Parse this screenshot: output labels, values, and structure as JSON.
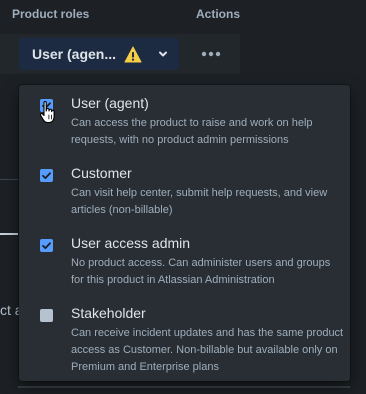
{
  "header": {
    "product_roles": "Product roles",
    "actions": "Actions"
  },
  "role_select": {
    "value": "User (agen...",
    "icons": [
      "warning-icon",
      "chevron-down-icon"
    ]
  },
  "more_actions": {
    "icon": "more-horizontal-icon"
  },
  "background": {
    "clipped_text": "ct a"
  },
  "options": [
    {
      "title": "User (agent)",
      "description": "Can access the product to raise and work on help requests, with no product admin permissions",
      "checked": true
    },
    {
      "title": "Customer",
      "description": "Can visit help center, submit help requests, and view articles (non-billable)",
      "checked": true
    },
    {
      "title": "User access admin",
      "description": "No product access. Can administer users and groups for this product in Atlassian Administration",
      "checked": true
    },
    {
      "title": "Stakeholder",
      "description": "Can receive incident updates and has the same product access as Customer. Non-billable but available only on Premium and Enterprise plans",
      "checked": false
    }
  ],
  "colors": {
    "background": "#1d2125",
    "dropdown": "#282e33",
    "select_bg": "#1c2b41",
    "checkbox_checked": "#579dff",
    "warning": "#f5cd47"
  }
}
